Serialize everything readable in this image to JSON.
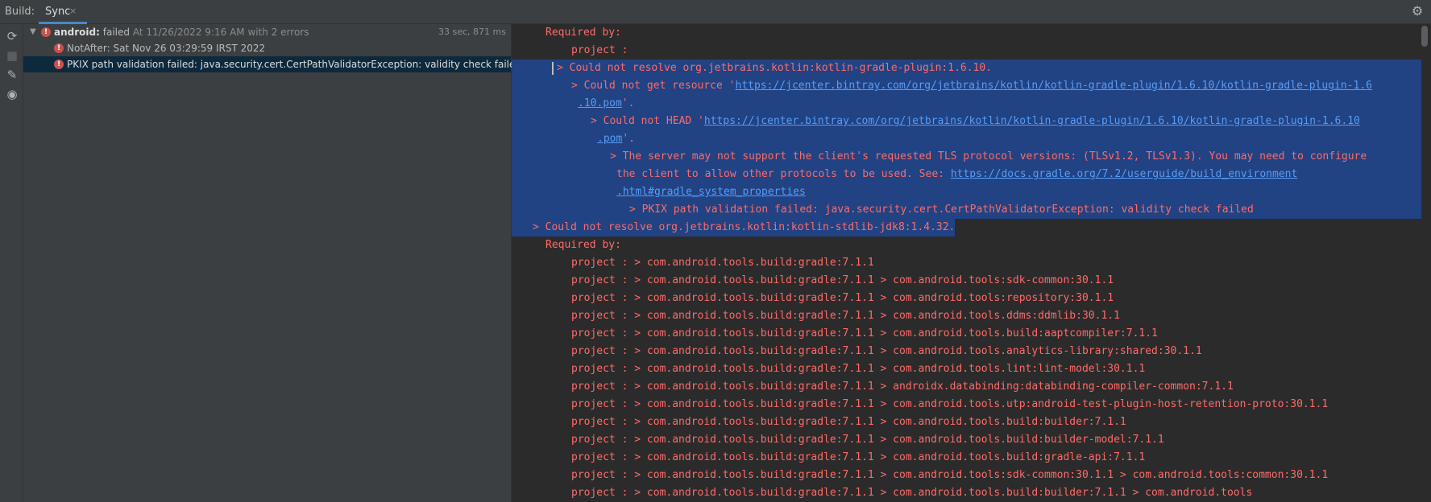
{
  "header": {
    "build_label": "Build:",
    "tab_label": "Sync",
    "tab_close": "×",
    "settings_icon": "gear-icon"
  },
  "toolbar": {
    "icons": [
      "sync-icon",
      "stop-icon",
      "pin-icon",
      "eye-icon"
    ]
  },
  "tree": {
    "root": {
      "name": "android:",
      "status": "failed",
      "detail": "At 11/26/2022 9:16 AM with 2 errors",
      "timing": "33 sec, 871 ms"
    },
    "items": [
      {
        "text": "NotAfter: Sat Nov 26 03:29:59 IRST 2022"
      },
      {
        "text": "PKIX path validation failed: java.security.cert.CertPathValidatorException: validity check failed"
      }
    ]
  },
  "console": {
    "colors": {
      "error_text": "#ff6b68",
      "link": "#589df6",
      "selection": "#214283"
    },
    "lines": [
      {
        "indent": 42,
        "text": "Required by:"
      },
      {
        "indent": 74,
        "text": "project :"
      },
      {
        "indent": 50,
        "text": "> Could not resolve org.jetbrains.kotlin:kotlin-gradle-plugin:1.6.10.",
        "selected": true,
        "caret": true
      },
      {
        "indent": 74,
        "text": "> Could not get resource '",
        "link": "https://jcenter.bintray.com/org/jetbrains/kotlin/kotlin-gradle-plugin/1.6.10/kotlin-gradle-plugin-1.6",
        "selected": true
      },
      {
        "indent": 82,
        "text": "",
        "link": ".10.pom",
        "after": "'.",
        "selected": true
      },
      {
        "indent": 98,
        "text": "> Could not HEAD '",
        "link": "https://jcenter.bintray.com/org/jetbrains/kotlin/kotlin-gradle-plugin/1.6.10/kotlin-gradle-plugin-1.6.10",
        "selected": true
      },
      {
        "indent": 106,
        "text": "",
        "link": ".pom",
        "after": "'.",
        "selected": true
      },
      {
        "indent": 122,
        "text": "> The server may not support the client's requested TLS protocol versions: (TLSv1.2, TLSv1.3). You may need to configure",
        "selected": true
      },
      {
        "indent": 130,
        "text": "the client to allow other protocols to be used. See: ",
        "link": "https://docs.gradle.org/7.2/userguide/build_environment",
        "selected": true
      },
      {
        "indent": 130,
        "text": "",
        "link": ".html#gradle_system_properties",
        "selected": true
      },
      {
        "indent": 146,
        "text": "> PKIX path validation failed: java.security.cert.CertPathValidatorException: validity check failed",
        "selected": true
      },
      {
        "indent": 26,
        "text": "> Could not resolve org.jetbrains.kotlin:kotlin-stdlib-jdk8:1.4.32.",
        "selected": true,
        "partial": true
      },
      {
        "indent": 42,
        "text": "Required by:"
      },
      {
        "indent": 74,
        "text": "project : > com.android.tools.build:gradle:7.1.1"
      },
      {
        "indent": 74,
        "text": "project : > com.android.tools.build:gradle:7.1.1 > com.android.tools:sdk-common:30.1.1"
      },
      {
        "indent": 74,
        "text": "project : > com.android.tools.build:gradle:7.1.1 > com.android.tools:repository:30.1.1"
      },
      {
        "indent": 74,
        "text": "project : > com.android.tools.build:gradle:7.1.1 > com.android.tools.ddms:ddmlib:30.1.1"
      },
      {
        "indent": 74,
        "text": "project : > com.android.tools.build:gradle:7.1.1 > com.android.tools.build:aaptcompiler:7.1.1"
      },
      {
        "indent": 74,
        "text": "project : > com.android.tools.build:gradle:7.1.1 > com.android.tools.analytics-library:shared:30.1.1"
      },
      {
        "indent": 74,
        "text": "project : > com.android.tools.build:gradle:7.1.1 > com.android.tools.lint:lint-model:30.1.1"
      },
      {
        "indent": 74,
        "text": "project : > com.android.tools.build:gradle:7.1.1 > androidx.databinding:databinding-compiler-common:7.1.1"
      },
      {
        "indent": 74,
        "text": "project : > com.android.tools.build:gradle:7.1.1 > com.android.tools.utp:android-test-plugin-host-retention-proto:30.1.1"
      },
      {
        "indent": 74,
        "text": "project : > com.android.tools.build:gradle:7.1.1 > com.android.tools.build:builder:7.1.1"
      },
      {
        "indent": 74,
        "text": "project : > com.android.tools.build:gradle:7.1.1 > com.android.tools.build:builder-model:7.1.1"
      },
      {
        "indent": 74,
        "text": "project : > com.android.tools.build:gradle:7.1.1 > com.android.tools.build:gradle-api:7.1.1"
      },
      {
        "indent": 74,
        "text": "project : > com.android.tools.build:gradle:7.1.1 > com.android.tools:sdk-common:30.1.1 > com.android.tools:common:30.1.1"
      },
      {
        "indent": 74,
        "text": "project : > com.android.tools.build:gradle:7.1.1 > com.android.tools.build:builder:7.1.1 > com.android.tools"
      }
    ]
  }
}
